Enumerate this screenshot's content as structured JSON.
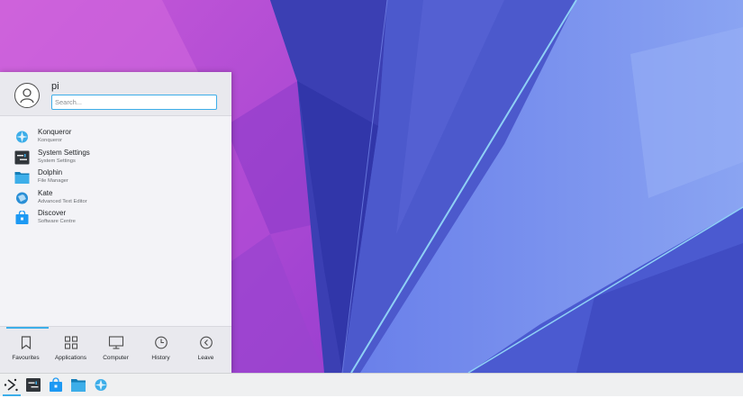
{
  "launcher": {
    "user": {
      "name": "pi",
      "avatar_icon": "user-avatar-icon"
    },
    "search": {
      "value": "",
      "placeholder": "Search..."
    },
    "favourites": [
      {
        "title": "Konqueror",
        "subtitle": "Konqueror",
        "icon": "konqueror-icon"
      },
      {
        "title": "System Settings",
        "subtitle": "System Settings",
        "icon": "system-settings-icon"
      },
      {
        "title": "Dolphin",
        "subtitle": "File Manager",
        "icon": "dolphin-folder-icon"
      },
      {
        "title": "Kate",
        "subtitle": "Advanced Text Editor",
        "icon": "kate-icon"
      },
      {
        "title": "Discover",
        "subtitle": "Software Centre",
        "icon": "discover-bag-icon"
      }
    ],
    "tabs": [
      {
        "label": "Favourites",
        "icon": "bookmark-icon",
        "active": true
      },
      {
        "label": "Applications",
        "icon": "grid-icon",
        "active": false
      },
      {
        "label": "Computer",
        "icon": "monitor-icon",
        "active": false
      },
      {
        "label": "History",
        "icon": "clock-icon",
        "active": false
      },
      {
        "label": "Leave",
        "icon": "back-arrow-icon",
        "active": false
      }
    ]
  },
  "taskbar": {
    "items": [
      "launcher-icon",
      "system-settings-icon",
      "discover-bag-icon",
      "dolphin-folder-icon",
      "konqueror-icon"
    ]
  },
  "colors": {
    "accent": "#3daee9",
    "panel_bg": "#f3f3f7",
    "taskbar_bg": "#eff0f1",
    "wallpaper_purple": "#b44fd8",
    "wallpaper_blue": "#4a55c9"
  }
}
